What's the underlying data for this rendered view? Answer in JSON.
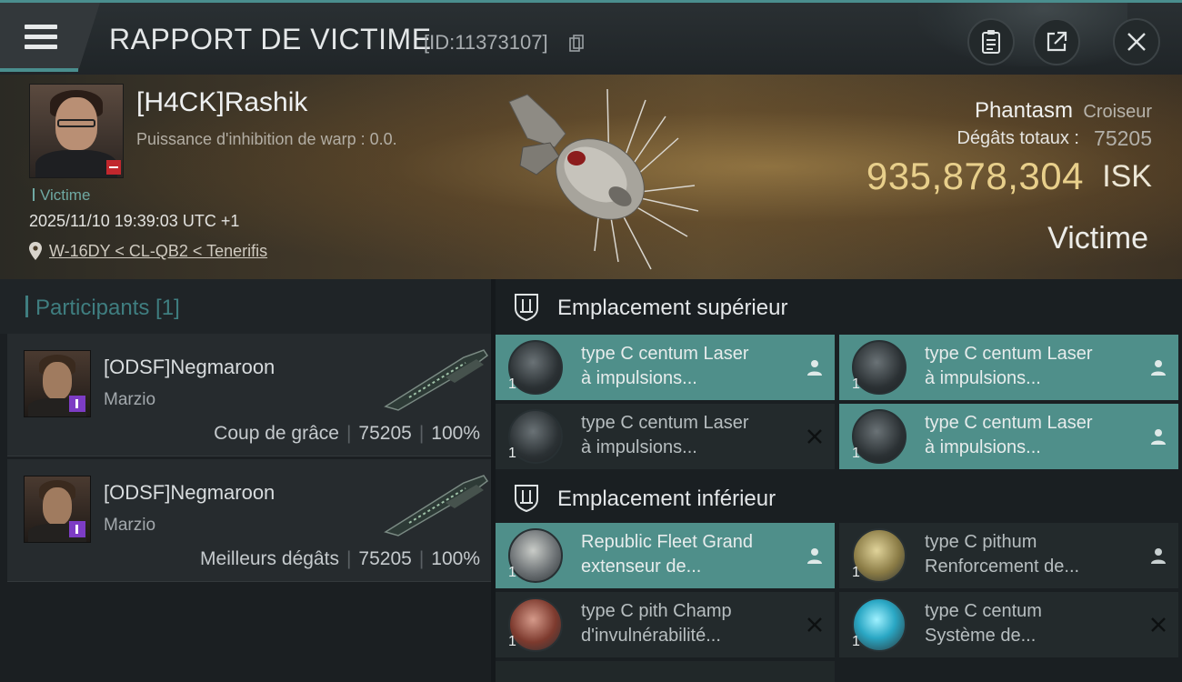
{
  "header": {
    "menu_icon": "hamburger-icon",
    "title": "RAPPORT DE VICTIME",
    "report_id": "[ID:11373107]",
    "buttons": [
      "clipboard-icon",
      "share-icon",
      "close-icon"
    ]
  },
  "victim": {
    "name": "[H4CK]Rashik",
    "warp_power": "Puissance d'inhibition de warp : 0.0.",
    "tag": "Victime",
    "timestamp": "2025/11/10 19:39:03 UTC +1",
    "location": "W-16DY < CL-QB2 < Tenerifis",
    "ship_name": "Phantasm",
    "ship_class": "Croiseur",
    "total_damage_label": "Dégâts totaux :",
    "total_damage": "75205",
    "isk_value": "935,878,304",
    "isk_unit": "ISK",
    "result": "Victime"
  },
  "participants": {
    "title": "Participants [1]",
    "rows": [
      {
        "name": "[ODSF]Negmaroon",
        "corp": "Marzio",
        "label": "Coup de grâce",
        "damage": "75205",
        "percent": "100%"
      },
      {
        "name": "[ODSF]Negmaroon",
        "corp": "Marzio",
        "label": "Meilleurs dégâts",
        "damage": "75205",
        "percent": "100%"
      }
    ]
  },
  "high_slots": {
    "title": "Emplacement supérieur",
    "modules": [
      {
        "line1": "type C centum Laser",
        "line2": "à impulsions...",
        "qty": "1",
        "status": "fitted"
      },
      {
        "line1": "type C centum Laser",
        "line2": "à impulsions...",
        "qty": "1",
        "status": "fitted"
      },
      {
        "line1": "type C centum Laser",
        "line2": "à impulsions...",
        "qty": "1",
        "status": "destroyed"
      },
      {
        "line1": "type C centum Laser",
        "line2": "à impulsions...",
        "qty": "1",
        "status": "fitted"
      }
    ]
  },
  "low_slots": {
    "title": "Emplacement inférieur",
    "modules": [
      {
        "line1": "Republic Fleet Grand",
        "line2": "extenseur de...",
        "qty": "1",
        "status": "fitted"
      },
      {
        "line1": "type C pithum",
        "line2": "Renforcement de...",
        "qty": "1",
        "status": "fitted"
      },
      {
        "line1": "type C pith Champ",
        "line2": "d'invulnérabilité...",
        "qty": "1",
        "status": "destroyed"
      },
      {
        "line1": "type C centum",
        "line2": "Système de...",
        "qty": "1",
        "status": "destroyed"
      }
    ]
  },
  "colors": {
    "accent": "#4a8e8e",
    "fitted_bg": "#4f8f8a",
    "empty_bg": "#232a2c",
    "isk_gold": "#e8cf8b",
    "victim_badge": "#c1272d",
    "attacker_badge": "#7d3cc4"
  }
}
